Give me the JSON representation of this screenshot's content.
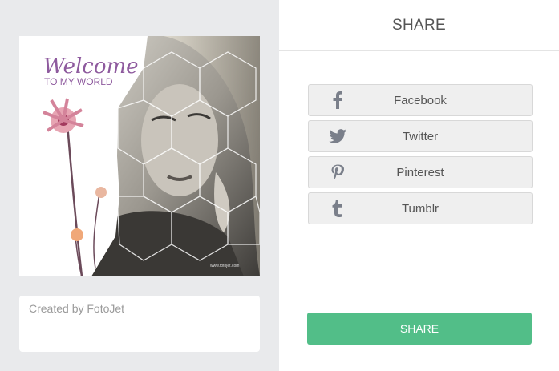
{
  "preview": {
    "welcome_text": "Welcome",
    "subtitle_text": "TO MY WORLD",
    "watermark": "www.fotojet.com"
  },
  "caption": {
    "placeholder": "Created by FotoJet",
    "value": ""
  },
  "share_panel": {
    "title": "SHARE",
    "buttons": [
      {
        "label": "Facebook",
        "icon": "facebook-icon"
      },
      {
        "label": "Twitter",
        "icon": "twitter-icon"
      },
      {
        "label": "Pinterest",
        "icon": "pinterest-icon"
      },
      {
        "label": "Tumblr",
        "icon": "tumblr-icon"
      }
    ],
    "submit_label": "SHARE"
  },
  "colors": {
    "accent_green": "#52be88",
    "left_bg": "#e9eaec",
    "icon_gray": "#7a7f8a",
    "welcome_purple": "#8e5a9e"
  }
}
